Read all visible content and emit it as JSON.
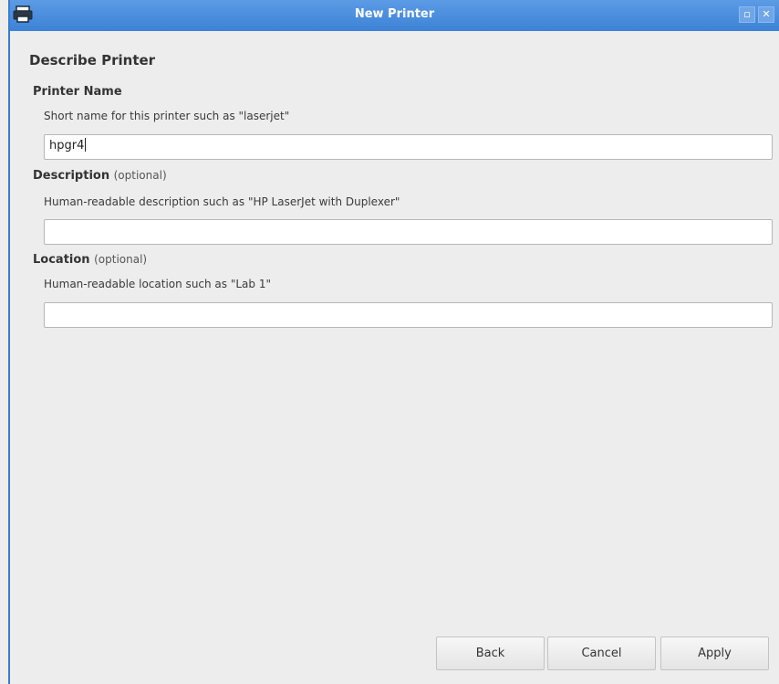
{
  "window": {
    "title": "New Printer",
    "app_icon": "printer-icon",
    "maximize_glyph": "▫",
    "close_glyph": "✕"
  },
  "page": {
    "heading": "Describe Printer"
  },
  "fields": {
    "printer_name": {
      "label": "Printer Name",
      "hint": "Short name for this printer such as \"laserjet\"",
      "value": "hpgr4"
    },
    "description": {
      "label": "Description",
      "optional": "(optional)",
      "hint": "Human-readable description such as \"HP LaserJet with Duplexer\"",
      "value": ""
    },
    "location": {
      "label": "Location",
      "optional": "(optional)",
      "hint": "Human-readable location such as \"Lab 1\"",
      "value": ""
    }
  },
  "buttons": {
    "back": "Back",
    "cancel": "Cancel",
    "apply": "Apply"
  },
  "colors": {
    "titlebar": "#3d82d6",
    "background": "#ededed"
  }
}
